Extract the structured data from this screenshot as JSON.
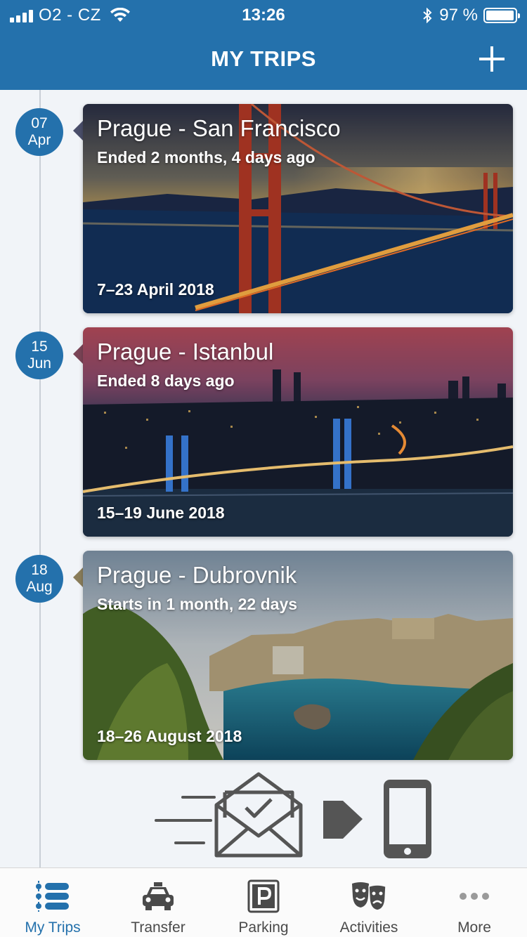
{
  "status_bar": {
    "carrier": "O2 - CZ",
    "time": "13:26",
    "battery": "97 %",
    "battery_level": 0.97
  },
  "header": {
    "title": "MY TRIPS"
  },
  "trips": [
    {
      "day": "07",
      "month": "Apr",
      "title": "Prague - San Francisco",
      "status": "Ended 2 months, 4 days ago",
      "dates": "7–23 April 2018"
    },
    {
      "day": "15",
      "month": "Jun",
      "title": "Prague - Istanbul",
      "status": "Ended 8 days ago",
      "dates": "15–19 June 2018"
    },
    {
      "day": "18",
      "month": "Aug",
      "title": "Prague - Dubrovnik",
      "status": "Starts in 1 month, 22 days",
      "dates": "18–26 August 2018"
    }
  ],
  "tabs": [
    {
      "label": "My Trips",
      "icon": "timeline-list-icon",
      "active": true
    },
    {
      "label": "Transfer",
      "icon": "taxi-icon",
      "active": false
    },
    {
      "label": "Parking",
      "icon": "parking-icon",
      "active": false
    },
    {
      "label": "Activities",
      "icon": "theater-masks-icon",
      "active": false
    },
    {
      "label": "More",
      "icon": "more-dots-icon",
      "active": false
    }
  ],
  "colors": {
    "primary": "#2471ac",
    "background": "#f1f4f8",
    "tab_inactive": "#4a4a4a"
  }
}
